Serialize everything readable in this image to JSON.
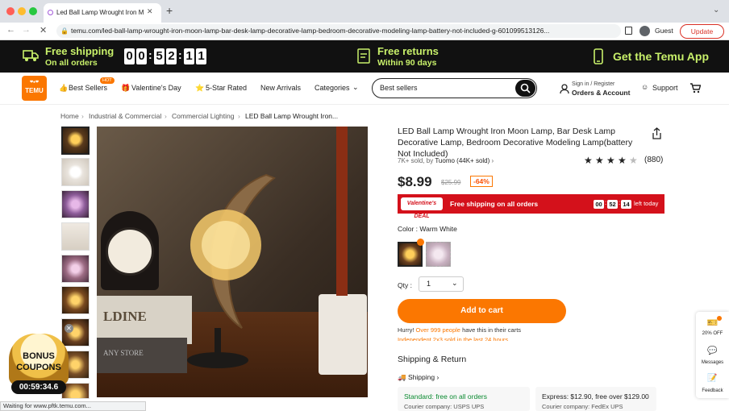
{
  "browser": {
    "tab_title": "Led Ball Lamp Wrought Iron M",
    "url": "temu.com/led-ball-lamp-wrought-iron-moon-lamp-bar-desk-lamp-decorative-lamp-bedroom-decorative-modeling-lamp-battery-not-included-g-601099513126...",
    "profile": "Guest",
    "update_label": "Update",
    "status": "Waiting for www.pftk.temu.com..."
  },
  "promo": {
    "free_shipping": "Free shipping",
    "on_all_orders": "On all orders",
    "timer_digits": [
      "0",
      "0",
      "5",
      "2",
      "1",
      "1"
    ],
    "free_returns": "Free returns",
    "within_90_days": "Within 90 days",
    "get_app": "Get the Temu App"
  },
  "nav": {
    "logo_top": "❤♠❤",
    "logo_text": "TEMU",
    "hot_badge": "HOT",
    "best_sellers": "Best Sellers",
    "valentines": "Valentine's Day",
    "five_star": "5-Star Rated",
    "new_arrivals": "New Arrivals",
    "categories": "Categories",
    "search_value": "Best sellers",
    "signin_line1": "Sign in / Register",
    "signin_line2": "Orders & Account",
    "support": "Support"
  },
  "breadcrumb": [
    "Home",
    "Industrial & Commercial",
    "Commercial Lighting",
    "LED Ball Lamp Wrought Iron..."
  ],
  "product": {
    "title": "LED Ball Lamp Wrought Iron Moon Lamp, Bar Desk Lamp Decorative Lamp, Bedroom Decorative Modeling Lamp(battery Not Included)",
    "sold_prefix": "7K+ sold, by",
    "store": "Tuomo (44K+ sold)",
    "rating": 4.5,
    "review_count": "(880)",
    "price": "$8.99",
    "old_price": "$25.99",
    "discount": "-64%",
    "deal_badge": "Valentine's DEAL",
    "deal_text": "Free shipping on all orders",
    "deal_timer": [
      "00",
      "52",
      "14"
    ],
    "deal_left": "left today",
    "color_label": "Color : Warm White",
    "qty_label": "Qty :",
    "qty_value": "1",
    "add_to_cart": "Add to cart",
    "hurry_a": "Hurry!",
    "hurry_b": "Over 999 people",
    "hurry_c": "have this in their carts",
    "hurry_d": "Independent 2x3 sold in the last 24 hours",
    "shipping_return": "Shipping & Return",
    "shipping": "Shipping",
    "standard": "Standard: free on all orders",
    "standard_courier": "Courier company:",
    "usps": "USPS",
    "ups": "UPS",
    "express": "Express: $12.90, free over $129.00",
    "express_courier": "Courier company:",
    "fedex": "FedEx",
    "ups2": "UPS"
  },
  "image": {
    "label": "LDINE",
    "label2": "ANY STORE"
  },
  "side": {
    "off": "20% OFF",
    "messages": "Messages",
    "feedback": "Feedback"
  },
  "coupon": {
    "line1": "BONUS",
    "line2": "COUPONS",
    "timer": "00:59:34.6"
  },
  "colors": {
    "temu_orange": "#fb7701",
    "promo_green": "#c8f06a",
    "deal_red": "#d4111b"
  }
}
